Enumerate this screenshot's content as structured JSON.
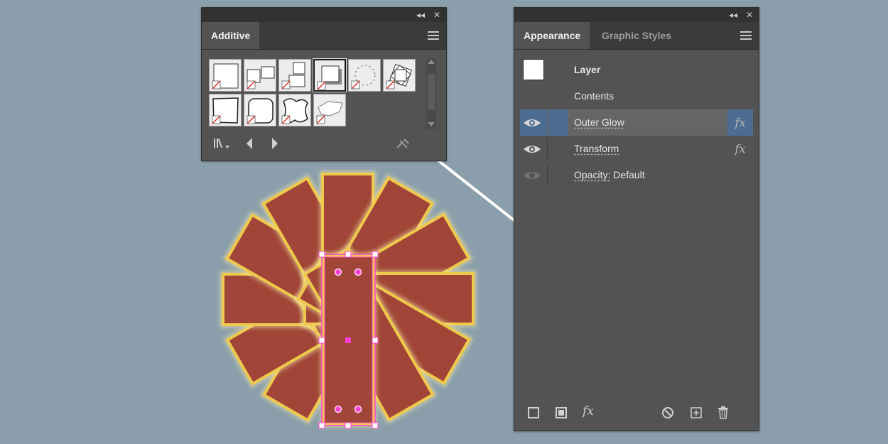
{
  "graphic_styles_panel": {
    "tab_label": "Additive",
    "collapse_glyph": "◂◂",
    "close_glyph": "✕",
    "styles": [
      "default-square",
      "side-by-side",
      "stacked",
      "drop-shadow",
      "dotted-ring",
      "rotated-squares",
      "rough-edge",
      "rounded-corner",
      "wavy-blob",
      "torn-blob"
    ],
    "selected_index": 3
  },
  "appearance_panel": {
    "tabs": [
      "Appearance",
      "Graphic Styles"
    ],
    "active_tab": 0,
    "collapse_glyph": "◂◂",
    "close_glyph": "✕",
    "rows": {
      "layer_label": "Layer",
      "contents_label": "Contents",
      "outer_glow_label": "Outer Glow",
      "transform_label": "Transform",
      "opacity_label": "Opacity:",
      "opacity_value": "Default",
      "fx_glyph": "fx"
    },
    "bottom_fx": "fx"
  },
  "colors": {
    "canvas": "#8a9fab",
    "shape_fill": "#a04537",
    "shape_stroke": "#efc94c",
    "selection": "#ff3fd2",
    "selected_row": "#656565",
    "fx_highlight": "#4d6c92"
  }
}
